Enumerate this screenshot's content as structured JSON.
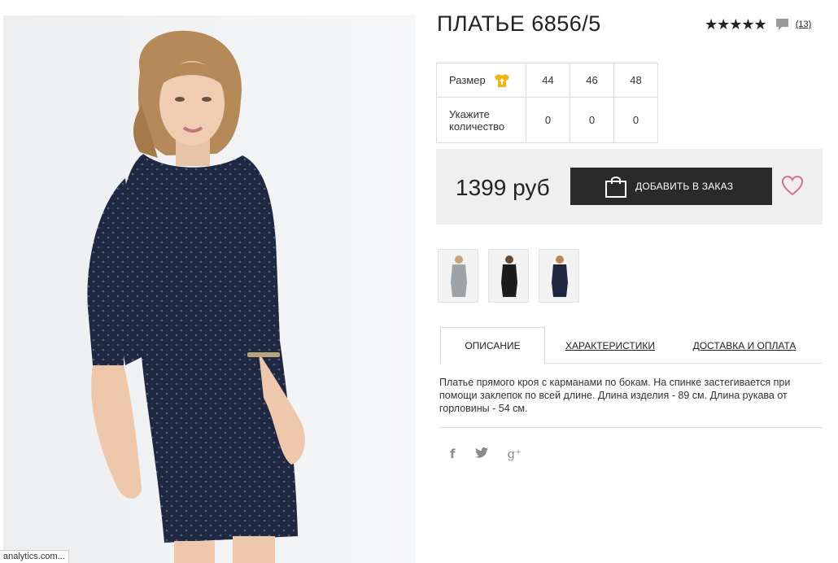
{
  "product": {
    "title": "ПЛАТЬЕ 6856/5",
    "rating_stars": "★★★★★",
    "reviews_count": "(13)",
    "price": "1399 руб",
    "add_to_order_label": "ДОБАВИТЬ В ЗАКАЗ",
    "description": "Платье прямого кроя с карманами по бокам. На спинке застегивается при помощи заклепок по всей длине. Длина изделия - 89 см. Длина рукава от горловины - 54 см."
  },
  "size_table": {
    "size_label": "Размер",
    "sizes": [
      "44",
      "46",
      "48"
    ],
    "quantity_label": "Укажите количество",
    "quantities": [
      "0",
      "0",
      "0"
    ]
  },
  "tabs": [
    {
      "label": "ОПИСАНИЕ",
      "active": true
    },
    {
      "label": "ХАРАКТЕРИСТИКИ",
      "active": false
    },
    {
      "label": "ДОСТАВКА И ОПЛАТА",
      "active": false
    }
  ],
  "social": {
    "facebook": "f",
    "twitter": "🐦",
    "google_plus": "g⁺"
  },
  "status_bar": "analytics.com...",
  "colors": {
    "button_bg": "#2a2a2a",
    "price_block_bg": "#efefef",
    "icon_yellow": "#f3b312",
    "heart": "#d4738a",
    "dress_navy": "#1f2840"
  },
  "icons": [
    "comment-icon",
    "shirt-size-icon",
    "shopping-bag-icon",
    "heart-icon",
    "facebook-icon",
    "twitter-icon",
    "google-plus-icon"
  ]
}
